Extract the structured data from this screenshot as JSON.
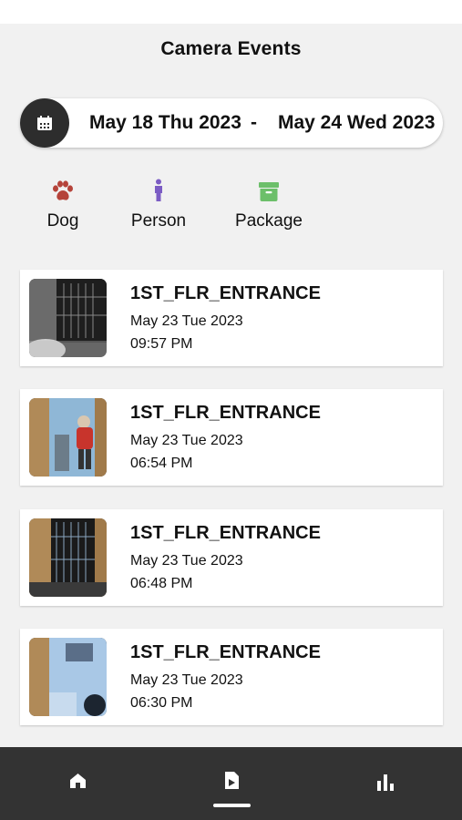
{
  "header": {
    "title": "Camera Events"
  },
  "date_range": {
    "start": "May 18 Thu 2023",
    "separator": "-",
    "end": "May 24 Wed 2023",
    "icon": "calendar-icon"
  },
  "filters": [
    {
      "label": "Dog",
      "icon": "paw-icon",
      "color": "#b5433a"
    },
    {
      "label": "Person",
      "icon": "person-icon",
      "color": "#7b5cc4"
    },
    {
      "label": "Package",
      "icon": "package-icon",
      "color": "#6cbf6a"
    }
  ],
  "events": [
    {
      "camera": "1ST_FLR_ENTRANCE",
      "date": "May 23 Tue 2023",
      "time": "09:57 PM"
    },
    {
      "camera": "1ST_FLR_ENTRANCE",
      "date": "May 23 Tue 2023",
      "time": "06:54 PM"
    },
    {
      "camera": "1ST_FLR_ENTRANCE",
      "date": "May 23 Tue 2023",
      "time": "06:48 PM"
    },
    {
      "camera": "1ST_FLR_ENTRANCE",
      "date": "May 23 Tue 2023",
      "time": "06:30 PM"
    }
  ],
  "nav": {
    "items": [
      {
        "icon": "home-icon"
      },
      {
        "icon": "events-document-icon",
        "active": true
      },
      {
        "icon": "bar-chart-icon"
      }
    ]
  }
}
